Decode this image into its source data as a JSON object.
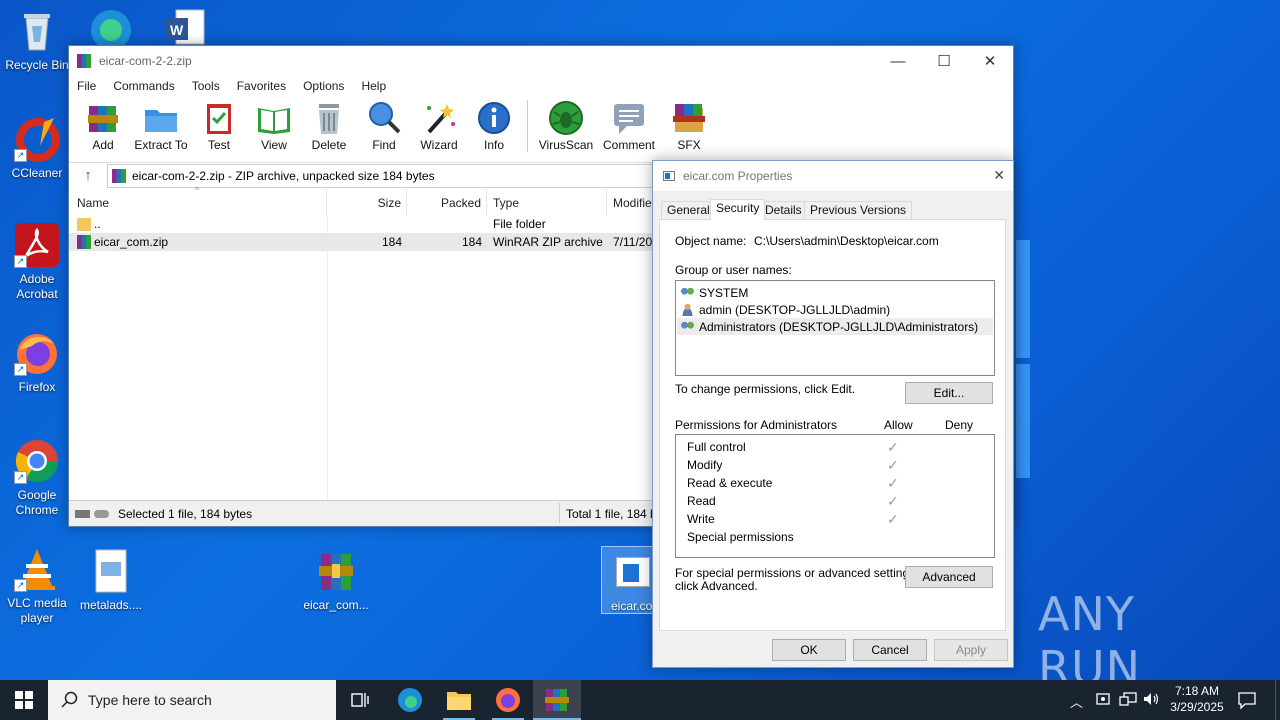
{
  "desktop": {
    "icons": [
      {
        "label": "Recycle Bin"
      },
      {
        "label": "CCleaner"
      },
      {
        "label": "Adobe Acrobat"
      },
      {
        "label": "Firefox"
      },
      {
        "label": "Google Chrome"
      },
      {
        "label": "VLC media player"
      },
      {
        "label": "metalads...."
      },
      {
        "label": "eicar_com..."
      },
      {
        "label": "eicar.co"
      }
    ],
    "watermark": "ANY RUN"
  },
  "winrar": {
    "title": "eicar-com-2-2.zip",
    "menu": [
      "File",
      "Commands",
      "Tools",
      "Favorites",
      "Options",
      "Help"
    ],
    "toolbar": [
      "Add",
      "Extract To",
      "Test",
      "View",
      "Delete",
      "Find",
      "Wizard",
      "Info",
      "VirusScan",
      "Comment",
      "SFX"
    ],
    "address": "eicar-com-2-2.zip - ZIP archive, unpacked size 184 bytes",
    "columns": [
      "Name",
      "Size",
      "Packed",
      "Type",
      "Modifie"
    ],
    "rows": [
      {
        "name": "..",
        "size": "",
        "packed": "",
        "type": "File folder",
        "modified": ""
      },
      {
        "name": "eicar_com.zip",
        "size": "184",
        "packed": "184",
        "type": "WinRAR ZIP archive",
        "modified": "7/11/20"
      }
    ],
    "status_left": "Selected 1 file, 184 bytes",
    "status_right": "Total 1 file, 184 b"
  },
  "properties": {
    "title": "eicar.com Properties",
    "tabs": [
      "General",
      "Security",
      "Details",
      "Previous Versions"
    ],
    "object_label": "Object name:",
    "object_value": "C:\\Users\\admin\\Desktop\\eicar.com",
    "group_label": "Group or user names:",
    "users": [
      "SYSTEM",
      "admin (DESKTOP-JGLLJLD\\admin)",
      "Administrators (DESKTOP-JGLLJLD\\Administrators)"
    ],
    "change_text": "To change permissions, click Edit.",
    "edit_button": "Edit...",
    "perm_label": "Permissions for Administrators",
    "allow": "Allow",
    "deny": "Deny",
    "permissions": [
      "Full control",
      "Modify",
      "Read & execute",
      "Read",
      "Write",
      "Special permissions"
    ],
    "special_text_1": "For special permissions or advanced settings,",
    "special_text_2": "click Advanced.",
    "advanced_button": "Advanced",
    "ok": "OK",
    "cancel": "Cancel",
    "apply": "Apply"
  },
  "taskbar": {
    "search_placeholder": "Type here to search",
    "time": "7:18 AM",
    "date": "3/29/2025"
  }
}
